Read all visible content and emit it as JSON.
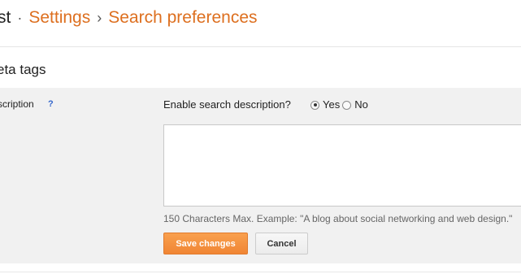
{
  "breadcrumb": {
    "first": "st",
    "separator_dot": "·",
    "settings": "Settings",
    "separator_arrow": "›",
    "current": "Search preferences"
  },
  "section": {
    "title": "eta tags"
  },
  "description_setting": {
    "label": "scription",
    "help": "?",
    "enable_label": "Enable search description?",
    "yes_label": "Yes",
    "no_label": "No",
    "selected": "Yes",
    "textarea_value": "",
    "hint": "150 Characters Max. Example: \"A blog about social networking and web design.\""
  },
  "actions": {
    "save_label": "Save changes",
    "cancel_label": "Cancel"
  },
  "colors": {
    "accent": "#dd6f1f",
    "save_button": "#f7913d",
    "panel_bg": "#f1f1f1"
  }
}
